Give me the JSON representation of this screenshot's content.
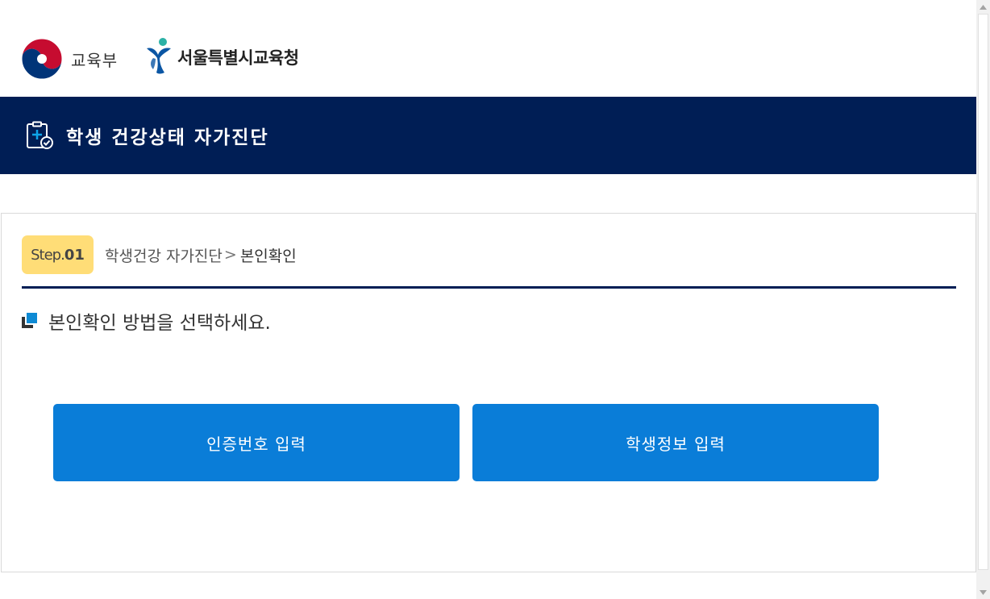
{
  "header": {
    "moe_name": "교육부",
    "sen_name": "서울특별시교육청"
  },
  "banner": {
    "title": "학생 건강상태 자가진단",
    "icon": "clipboard-check-icon"
  },
  "step": {
    "badge_prefix": "Step.",
    "badge_number": "01",
    "breadcrumb_parent": "학생건강 자가진단",
    "breadcrumb_separator": ">",
    "breadcrumb_current": "본인확인"
  },
  "instruction": {
    "text": "본인확인 방법을 선택하세요."
  },
  "buttons": {
    "auth_code": "인증번호 입력",
    "student_info": "학생정보 입력"
  },
  "colors": {
    "banner_bg": "#001e55",
    "button_bg": "#0a7dd8",
    "step_badge_bg": "#ffdd77"
  }
}
